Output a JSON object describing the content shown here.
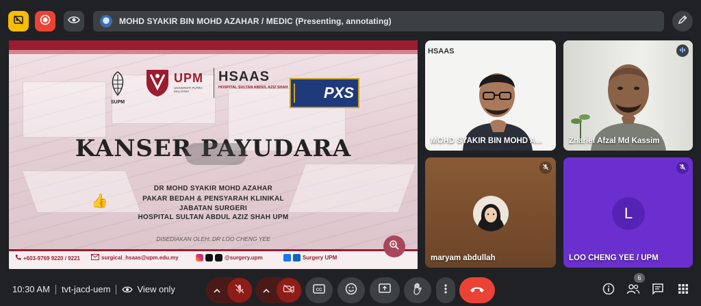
{
  "top_bar": {
    "presenting_text": "MOHD SYAKIR BIN MOHD AZAHAR / MEDIC (Presenting, annotating)",
    "icons": [
      "closed-caption-off-icon",
      "record-icon",
      "eye-icon",
      "pen-icon"
    ]
  },
  "slide": {
    "logos": {
      "supm": "SUPM",
      "upm": "UPM",
      "upm_sub": "UNIVERSITI PUTRA MALAYSIA",
      "hsaas": "HSAAS",
      "hsaas_sub": "HOSPITAL SULTAN ABDUL AZIZ SHAH",
      "pxs": "PXS"
    },
    "title": "KANSER PAYUDARA",
    "presenter_lines": [
      "DR MOHD SYAKIR MOHD AZAHAR",
      "PAKAR BEDAH & PENSYARAH KLINIKAL",
      "JABATAN SURGERI",
      "HOSPITAL SULTAN ABDUL AZIZ SHAH UPM"
    ],
    "prepared_by": "DISEDIAKAN OLEH: DR LOO CHENG YEE",
    "footer": {
      "phone": "+603-9769 9220 / 9221",
      "email": "surgical_hsaas@upm.edu.my",
      "social": "@surgery.upm",
      "facebook": "Surgery UPM"
    },
    "reaction": "👍"
  },
  "participants": [
    {
      "name": "MOHD SYAKIR BIN MOHD A...",
      "muted": false,
      "speaking": false
    },
    {
      "name": "Zharief Afzal Md Kassim",
      "muted": false,
      "speaking": true
    },
    {
      "name": "maryam abdullah",
      "muted": true,
      "speaking": false
    },
    {
      "name": "LOO CHENG YEE / UPM",
      "muted": true,
      "speaking": false,
      "initial": "L"
    }
  ],
  "bottom_bar": {
    "time": "10:30 AM",
    "meeting_code": "tvt-jacd-uem",
    "view_mode": "View only",
    "participant_count": "6"
  },
  "colors": {
    "end_call": "#ea4335",
    "muted_control": "#8c1d18",
    "upm_red": "#9b1c2e",
    "tile_purple": "#6b2fd0"
  }
}
